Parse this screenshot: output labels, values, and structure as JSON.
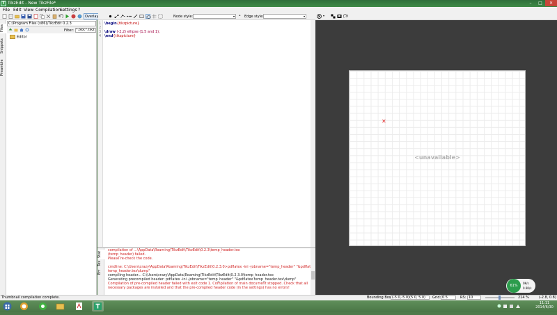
{
  "window": {
    "title": "TikzEdit - New TikzFile*",
    "app_letter": "T",
    "min": "–",
    "max": "□",
    "close": "✕"
  },
  "menu": [
    "File",
    "Edit",
    "View",
    "Compilation",
    "Settings",
    "?"
  ],
  "toolbar": {
    "overlay": "Overlay",
    "node_style_label": "Node style:",
    "edge_style_label": "Edge style:"
  },
  "side_tabs": [
    "Files",
    "Snippets",
    "Preamble"
  ],
  "file_panel": {
    "path": "C:\\Program Files (x86)\\TikzEdit 0.2.3",
    "filter_label": "Filter:",
    "filter_value": "*.tex;*.tikz",
    "tree": [
      "Editor"
    ]
  },
  "editor": {
    "line_numbers": [
      "1",
      "2",
      "3",
      "4"
    ],
    "lines": [
      {
        "cmd": "\\begin",
        "arg": "{tikzpicture}",
        "rest": ""
      },
      {
        "cmd": "",
        "arg": "",
        "rest": ""
      },
      {
        "cmd": "\\draw",
        "arg": "",
        "rest": " (-2,2) ellipse (1.5 and 1);"
      },
      {
        "cmd": "\\end",
        "arg": "{tikzpicture}",
        "rest": ""
      }
    ]
  },
  "messages": {
    "tabs": [
      "Stat",
      "Tex",
      "Err"
    ],
    "lines": [
      {
        "text": "compilation of ...\\AppData\\Roaming\\TikzEdit\\TikzEdit\\0.2.3\\temp_header.tex",
        "color": "red"
      },
      {
        "text": "(temp_header) failed.",
        "color": "red"
      },
      {
        "text": "Please re-check the code.",
        "color": "red"
      },
      {
        "text": "",
        "color": "red"
      },
      {
        "text": "cmdline: C:\\Users\\crazy\\AppData\\Roaming\\TikzEdit\\TikzEdit\\0.2.3.0>pdflatex -ini -jobname=\"temp_header\" \"&pdflatex",
        "color": "red"
      },
      {
        "text": "temp_header.tex\\dump\"",
        "color": "red"
      },
      {
        "text": "compiling header... C:\\Users\\crazy\\AppData\\Roaming\\TikzEdit\\TikzEdit\\0.2.3.0\\temp_header.tex",
        "color": "black"
      },
      {
        "text": "Generating precompiled header: pdflatex -ini -jobname=\"temp_header\" \"&pdflatex temp_header.tex\\dump\"",
        "color": "black"
      },
      {
        "text": "Compilation of pre-compiled header failed with exit code 1. Compilation of main document stopped. Check that all",
        "color": "red"
      },
      {
        "text": "necessary packages are installed and that the pre-compiled header code (in the settings) has no errors!",
        "color": "red"
      }
    ]
  },
  "preview": {
    "unavailable": "<unavailable>",
    "origin_marker": "✕",
    "widget_percent": "61%",
    "widget_up": "0K/s",
    "widget_down": "0.9K/s"
  },
  "status": {
    "left": "Thumbnail compilation complete.",
    "bounding_box_label": "Bounding Box:",
    "bounding_box_value": "(-5.0,-5.0)(5.0, 5.0)",
    "grid_label": "Grid:",
    "grid_value": "0.5",
    "rs_label": "RS:",
    "rs_value": "10",
    "zoom": "214 %",
    "coords": "(-2.8, 0.8)"
  },
  "taskbar": {
    "time": "11:11",
    "date": "2014/6/30"
  }
}
